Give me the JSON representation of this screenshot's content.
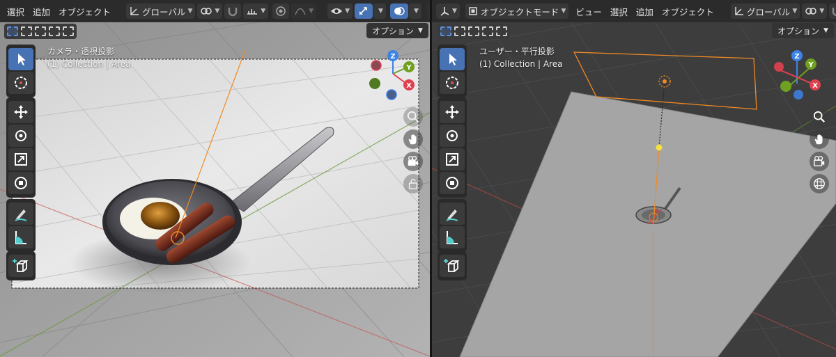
{
  "left_editor": {
    "menus": [
      "選択",
      "追加",
      "オブジェクト"
    ],
    "orientation_label": "グローバル",
    "options_label": "オプション",
    "view_name": "カメラ・透視投影",
    "collection_label": "(1) Collection | Area",
    "gizmo_axes": [
      "Z",
      "Y",
      "X"
    ]
  },
  "right_editor": {
    "mode_label": "オブジェクトモード",
    "menus": [
      "ビュー",
      "選択",
      "追加",
      "オブジェクト"
    ],
    "orientation_label": "グローバル",
    "options_label": "オプション",
    "view_name": "ユーザー・平行投影",
    "collection_label": "(1) Collection | Area",
    "gizmo_axes": [
      "Z",
      "Y",
      "X"
    ]
  },
  "colors": {
    "accent_blue": "#4772b3",
    "axis_x": "#e0414f",
    "axis_y": "#6fa020",
    "axis_z": "#3c82e8",
    "selection_orange": "#f08a24",
    "header_bg": "#2b2b2b"
  },
  "icons": {
    "tools": [
      "select-box-icon",
      "cursor-icon",
      "move-icon",
      "rotate-icon",
      "scale-icon",
      "transform-icon",
      "annotate-icon",
      "measure-icon",
      "add-cube-icon"
    ],
    "nav": [
      "zoom-icon",
      "hand-pan-icon",
      "camera-icon",
      "lock-icon",
      "grid-icon"
    ]
  }
}
